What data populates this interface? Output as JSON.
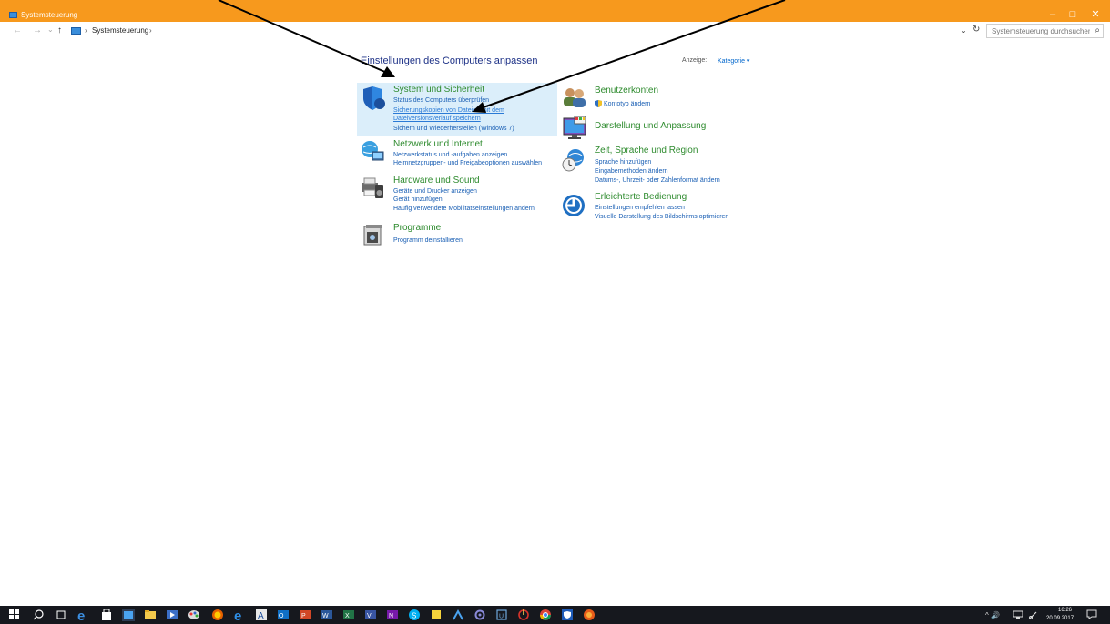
{
  "window": {
    "title": "Systemsteuerung",
    "minimize_glyph": "–",
    "maximize_glyph": "□",
    "close_glyph": "✕",
    "icon": "control-panel-icon"
  },
  "address": {
    "back_glyph": "←",
    "forward_glyph": "→",
    "history_glyph": "⌄",
    "up_glyph": "↑",
    "sep1": "›",
    "crumb": "Systemsteuerung",
    "sep2": "›",
    "dropdown_glyph": "⌄",
    "refresh_glyph": "↻",
    "search_placeholder": "Systemsteuerung durchsuchen",
    "search_icon": "⌕"
  },
  "main": {
    "title": "Einstellungen des Computers anpassen",
    "view_label": "Anzeige:",
    "view_value": "Kategorie ▾"
  },
  "left_categories": [
    {
      "title": "System und Sicherheit",
      "icon": "shield-icon",
      "links": [
        "Status des Computers überprüfen",
        "Sicherungskopien von Dateien mit dem",
        "Dateiversionsverlauf speichern",
        "Sichern und Wiederherstellen (Windows 7)"
      ]
    },
    {
      "title": "Netzwerk und Internet",
      "icon": "network-globe-icon",
      "links": [
        "Netzwerkstatus und -aufgaben anzeigen",
        "Heimnetzgruppen- und Freigabeoptionen auswählen"
      ]
    },
    {
      "title": "Hardware und Sound",
      "icon": "printer-speaker-icon",
      "links": [
        "Geräte und Drucker anzeigen",
        "Gerät hinzufügen",
        "Häufig verwendete Mobilitätseinstellungen ändern"
      ]
    },
    {
      "title": "Programme",
      "icon": "programs-icon",
      "links": [
        "Programm deinstallieren"
      ]
    }
  ],
  "right_categories": [
    {
      "title": "Benutzerkonten",
      "icon": "users-icon",
      "links": [
        "Kontotyp ändern"
      ]
    },
    {
      "title": "Darstellung und Anpassung",
      "icon": "display-icon",
      "links": []
    },
    {
      "title": "Zeit, Sprache und Region",
      "icon": "globe-clock-icon",
      "links": [
        "Sprache hinzufügen",
        "Eingabemethoden ändern",
        "Datums-, Uhrzeit- oder Zahlenformat ändern"
      ]
    },
    {
      "title": "Erleichterte Bedienung",
      "icon": "accessibility-icon",
      "links": [
        "Einstellungen empfehlen lassen",
        "Visuelle Darstellung des Bildschirms optimieren"
      ]
    }
  ],
  "taskbar": {
    "tray_text": "^ 🔊",
    "time": "16:26",
    "date": "20.09.2017"
  },
  "colors": {
    "titlebar": "#f7991d",
    "category_title": "#2e8b2e",
    "link": "#1a5fb4",
    "highlight": "#dbeefa",
    "taskbar": "#16181e"
  }
}
